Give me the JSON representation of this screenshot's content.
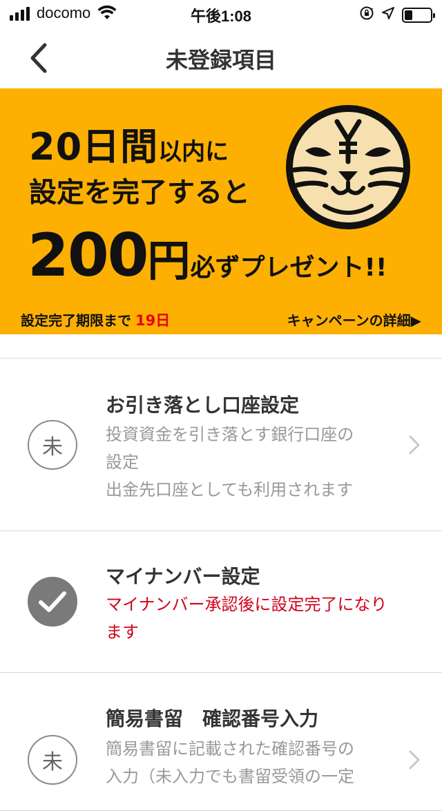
{
  "status_bar": {
    "carrier": "docomo",
    "time": "午後1:08",
    "battery_level": 0.3
  },
  "nav": {
    "title": "未登録項目"
  },
  "banner": {
    "days_big": "20日間",
    "days_suffix": "以内に",
    "line2": "設定を完了すると",
    "amount": "200",
    "yen": "円",
    "present": "必ずプレゼント!!",
    "deadline_label": "設定完了期限まで",
    "deadline_days": "19日",
    "campaign_link": "キャンペーンの詳細▶",
    "colors": {
      "background": "#fdb002",
      "accent_red": "#e60012"
    }
  },
  "items": [
    {
      "status": "未",
      "title": "お引き落とし口座設定",
      "desc_lines": [
        "投資資金を引き落とす銀行口座の",
        "設定",
        "出金先口座としても利用されます"
      ]
    },
    {
      "status": "done",
      "title": "マイナンバー設定",
      "desc_lines": [
        "マイナンバー承認後に設定完了になり",
        "ます"
      ]
    },
    {
      "status": "未",
      "title": "簡易書留　確認番号入力",
      "desc_lines": [
        "簡易書留に記載された確認番号の",
        "入力（未入力でも書留受領の一定"
      ]
    }
  ]
}
